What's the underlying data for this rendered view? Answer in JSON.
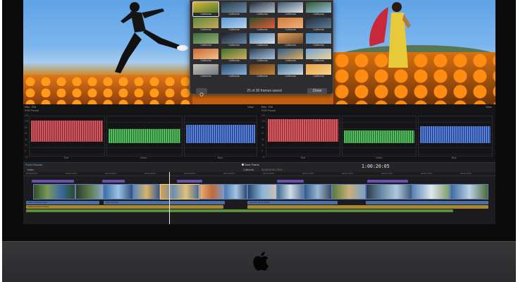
{
  "popup": {
    "thumbnails": [
      {
        "caption": "California",
        "c1": "#d8b43a",
        "c2": "#4f7a2c",
        "selected": true
      },
      {
        "caption": "California",
        "c1": "#2e3a44",
        "c2": "#6b8fb0",
        "selected": false
      },
      {
        "caption": "California",
        "c1": "#1f2a3a",
        "c2": "#bfc9d4",
        "selected": false
      },
      {
        "caption": "California",
        "c1": "#3a5570",
        "c2": "#e2e5e8",
        "selected": false
      },
      {
        "caption": "California",
        "c1": "#2f5a2a",
        "c2": "#9bc2e6",
        "selected": false
      },
      {
        "caption": "California",
        "c1": "#5b8a3c",
        "c2": "#c9a85a",
        "selected": false
      },
      {
        "caption": "California",
        "c1": "#5b9ad6",
        "c2": "#b7d3ea",
        "selected": false
      },
      {
        "caption": "California",
        "c1": "#2a4f2a",
        "c2": "#e45b3a",
        "selected": false
      },
      {
        "caption": "California",
        "c1": "#d27a3a",
        "c2": "#f0b07a",
        "selected": false
      },
      {
        "caption": "California",
        "c1": "#1f2c3a",
        "c2": "#5d7c9a",
        "selected": false
      },
      {
        "caption": "California",
        "c1": "#3a6a3a",
        "c2": "#9ab07a",
        "selected": false
      },
      {
        "caption": "California",
        "c1": "#1a1e24",
        "c2": "#6a8aa8",
        "selected": false
      },
      {
        "caption": "California",
        "c1": "#3f6f9f",
        "c2": "#dbe6ef",
        "selected": false
      },
      {
        "caption": "California",
        "c1": "#e7a25c",
        "c2": "#6b4a2a",
        "selected": false
      },
      {
        "caption": "California",
        "c1": "#4a7fb5",
        "c2": "#8fb0cc",
        "selected": false
      },
      {
        "caption": "California",
        "c1": "#c9683a",
        "c2": "#f3c28a",
        "selected": false
      },
      {
        "caption": "California",
        "c1": "#41702e",
        "c2": "#d3ae62",
        "selected": false
      },
      {
        "caption": "California",
        "c1": "#2b3f55",
        "c2": "#a9c5df",
        "selected": false
      },
      {
        "caption": "California",
        "c1": "#2e5a8a",
        "c2": "#e0b060",
        "selected": false
      },
      {
        "caption": "California",
        "c1": "#6aa4d8",
        "c2": "#f2d39a",
        "selected": false
      },
      {
        "caption": "California",
        "c1": "#c8c2b4",
        "c2": "#6f7a86",
        "selected": false
      },
      {
        "caption": "California",
        "c1": "#27466a",
        "c2": "#8ab4dc",
        "selected": false
      },
      {
        "caption": "California",
        "c1": "#5a3a1e",
        "c2": "#c8863a",
        "selected": false
      },
      {
        "caption": "California",
        "c1": "#3f6c8f",
        "c2": "#cfdde8",
        "selected": false
      },
      {
        "caption": "California",
        "c1": "#e6a247",
        "c2": "#fbd28a",
        "selected": false
      }
    ],
    "status": "25 of 30 frames saved",
    "close_label": "Close"
  },
  "scopes": {
    "left": {
      "title": "Rec. 709",
      "sub": "RGB Parade",
      "view": "View"
    },
    "right": {
      "title": "Rec. 709",
      "sub": "RGB Parade",
      "view": "View"
    },
    "axis": [
      "120",
      "100",
      "80",
      "60",
      "40",
      "20",
      "0",
      "-20"
    ],
    "channels": [
      "Red",
      "Green",
      "Blue"
    ]
  },
  "toolbar": {
    "frame_browser": "Frame Browser",
    "save_frame": "Save Frame",
    "index": "Index",
    "project": "California",
    "project_info": "00:00:00:00 / 30:0...",
    "timecode": "1:00:20:05"
  },
  "timeline": {
    "ruler": [
      "00:00:00:00",
      "00:00:10:00",
      "00:00:20:00",
      "00:00:30:00",
      "00:00:40:00",
      "00:00:50:00",
      "00:01:00:00",
      "00:01:10:00",
      "00:01:20:00",
      "00:01:30:00",
      "00:01:40:00",
      "00:01:50:00"
    ],
    "audio_labels": [
      "California Desert Wind",
      "California Drive",
      "California Ambient Music",
      "California Ocean Waves"
    ]
  },
  "colors": {
    "accent": "#6aa5ef",
    "title_clip": "#6d4fb0",
    "audio_blue": "#4c6fa8",
    "audio_green": "#5e8e3a",
    "audio_gold": "#a88830"
  }
}
